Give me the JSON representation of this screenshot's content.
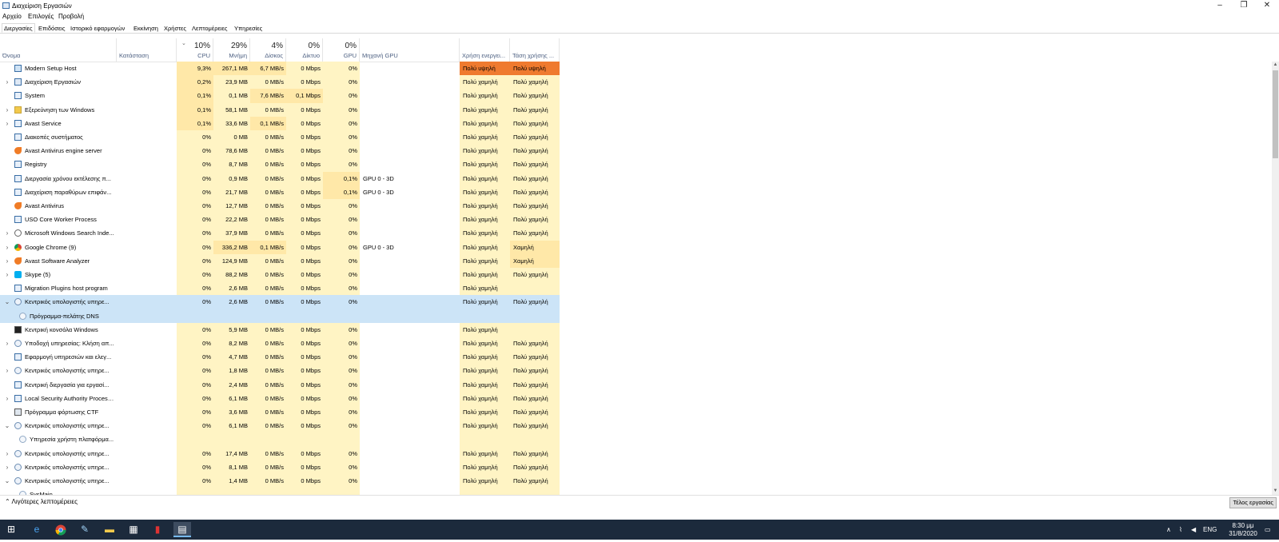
{
  "window": {
    "title": "Διαχείριση Εργασιών"
  },
  "menu": [
    "Αρχείο",
    "Επιλογές",
    "Προβολή"
  ],
  "tabs": [
    "Διεργασίες",
    "Επιδόσεις",
    "Ιστορικό εφαρμογών",
    "Εκκίνηση",
    "Χρήστες",
    "Λεπτομέρειες",
    "Υπηρεσίες"
  ],
  "columns": {
    "name": "Όνομα",
    "status": "Κατάσταση",
    "cpu": {
      "pct": "10%",
      "label": "CPU"
    },
    "mem": {
      "pct": "29%",
      "label": "Μνήμη"
    },
    "disk": {
      "pct": "4%",
      "label": "Δίσκος"
    },
    "net": {
      "pct": "0%",
      "label": "Δίκτυο"
    },
    "gpu": {
      "pct": "0%",
      "label": "GPU"
    },
    "gpu_engine": "Μηχανή GPU",
    "power": "Χρήση ενεργει...",
    "power_trend": "Τάση χρήσης ..."
  },
  "rows": [
    {
      "name": "Modern Setup Host",
      "icon": "setup-icon",
      "expand": "none",
      "cpu": "9,3%",
      "mem": "267,1 MB",
      "disk": "6,7 MB/s",
      "net": "0 Mbps",
      "gpu": "0%",
      "engine": "",
      "power": "Πολύ υψηλή",
      "trend": "Πολύ υψηλή",
      "heat": {
        "cpu": 2,
        "mem": 2,
        "disk": 2,
        "net": 1,
        "gpu": 1,
        "power": "o2",
        "trend": "o2"
      }
    },
    {
      "name": "Διαχείριση Εργασιών",
      "icon": "taskmgr-icon",
      "expand": "collapsed",
      "cpu": "0,2%",
      "mem": "23,9 MB",
      "disk": "0 MB/s",
      "net": "0 Mbps",
      "gpu": "0%",
      "engine": "",
      "power": "Πολύ χαμηλή",
      "trend": "Πολύ χαμηλή",
      "heat": {
        "cpu": 2,
        "mem": 1,
        "disk": 1,
        "net": 1,
        "gpu": 1,
        "power": "y1",
        "trend": "y1"
      }
    },
    {
      "name": "System",
      "icon": "system-icon",
      "expand": "none",
      "cpu": "0,1%",
      "mem": "0,1 MB",
      "disk": "7,6 MB/s",
      "net": "0,1 Mbps",
      "gpu": "0%",
      "engine": "",
      "power": "Πολύ χαμηλή",
      "trend": "Πολύ χαμηλή",
      "heat": {
        "cpu": 2,
        "mem": 1,
        "disk": 2,
        "net": 2,
        "gpu": 1,
        "power": "y1",
        "trend": "y1"
      }
    },
    {
      "name": "Εξερεύνηση των Windows",
      "icon": "folder-icon",
      "expand": "collapsed",
      "cpu": "0,1%",
      "mem": "58,1 MB",
      "disk": "0 MB/s",
      "net": "0 Mbps",
      "gpu": "0%",
      "engine": "",
      "power": "Πολύ χαμηλή",
      "trend": "Πολύ χαμηλή",
      "heat": {
        "cpu": 2,
        "mem": 1,
        "disk": 1,
        "net": 1,
        "gpu": 1,
        "power": "y1",
        "trend": "y1"
      }
    },
    {
      "name": "Avast Service",
      "icon": "app-window-icon",
      "expand": "collapsed",
      "cpu": "0,1%",
      "mem": "33,6 MB",
      "disk": "0,1 MB/s",
      "net": "0 Mbps",
      "gpu": "0%",
      "engine": "",
      "power": "Πολύ χαμηλή",
      "trend": "Πολύ χαμηλή",
      "heat": {
        "cpu": 2,
        "mem": 1,
        "disk": 2,
        "net": 1,
        "gpu": 1,
        "power": "y1",
        "trend": "y1"
      }
    },
    {
      "name": "Διακοπές συστήματος",
      "icon": "system-icon",
      "expand": "none",
      "cpu": "0%",
      "mem": "0 MB",
      "disk": "0 MB/s",
      "net": "0 Mbps",
      "gpu": "0%",
      "engine": "",
      "power": "Πολύ χαμηλή",
      "trend": "Πολύ χαμηλή",
      "heat": {
        "cpu": 1,
        "mem": 1,
        "disk": 1,
        "net": 1,
        "gpu": 1,
        "power": "y1",
        "trend": "y1"
      }
    },
    {
      "name": "Avast Antivirus engine server",
      "icon": "avast-icon",
      "expand": "none",
      "cpu": "0%",
      "mem": "78,6 MB",
      "disk": "0 MB/s",
      "net": "0 Mbps",
      "gpu": "0%",
      "engine": "",
      "power": "Πολύ χαμηλή",
      "trend": "Πολύ χαμηλή",
      "heat": {
        "cpu": 1,
        "mem": 1,
        "disk": 1,
        "net": 1,
        "gpu": 1,
        "power": "y1",
        "trend": "y1"
      }
    },
    {
      "name": "Registry",
      "icon": "app-window-icon",
      "expand": "none",
      "cpu": "0%",
      "mem": "8,7 MB",
      "disk": "0 MB/s",
      "net": "0 Mbps",
      "gpu": "0%",
      "engine": "",
      "power": "Πολύ χαμηλή",
      "trend": "Πολύ χαμηλή",
      "heat": {
        "cpu": 1,
        "mem": 1,
        "disk": 1,
        "net": 1,
        "gpu": 1,
        "power": "y1",
        "trend": "y1"
      }
    },
    {
      "name": "Διεργασία χρόνου εκτέλεσης π...",
      "icon": "app-window-icon",
      "expand": "none",
      "cpu": "0%",
      "mem": "0,9 MB",
      "disk": "0 MB/s",
      "net": "0 Mbps",
      "gpu": "0,1%",
      "engine": "GPU 0 - 3D",
      "power": "Πολύ χαμηλή",
      "trend": "Πολύ χαμηλή",
      "heat": {
        "cpu": 1,
        "mem": 1,
        "disk": 1,
        "net": 1,
        "gpu": 2,
        "power": "y1",
        "trend": "y1"
      }
    },
    {
      "name": "Διαχείριση παραθύρων επιφάν...",
      "icon": "app-window-icon",
      "expand": "none",
      "cpu": "0%",
      "mem": "21,7 MB",
      "disk": "0 MB/s",
      "net": "0 Mbps",
      "gpu": "0,1%",
      "engine": "GPU 0 - 3D",
      "power": "Πολύ χαμηλή",
      "trend": "Πολύ χαμηλή",
      "heat": {
        "cpu": 1,
        "mem": 1,
        "disk": 1,
        "net": 1,
        "gpu": 2,
        "power": "y1",
        "trend": "y1"
      }
    },
    {
      "name": "Avast Antivirus",
      "icon": "avast-icon",
      "expand": "none",
      "cpu": "0%",
      "mem": "12,7 MB",
      "disk": "0 MB/s",
      "net": "0 Mbps",
      "gpu": "0%",
      "engine": "",
      "power": "Πολύ χαμηλή",
      "trend": "Πολύ χαμηλή",
      "heat": {
        "cpu": 1,
        "mem": 1,
        "disk": 1,
        "net": 1,
        "gpu": 1,
        "power": "y1",
        "trend": "y1"
      }
    },
    {
      "name": "USO Core Worker Process",
      "icon": "app-window-icon",
      "expand": "none",
      "cpu": "0%",
      "mem": "22,2 MB",
      "disk": "0 MB/s",
      "net": "0 Mbps",
      "gpu": "0%",
      "engine": "",
      "power": "Πολύ χαμηλή",
      "trend": "Πολύ χαμηλή",
      "heat": {
        "cpu": 1,
        "mem": 1,
        "disk": 1,
        "net": 1,
        "gpu": 1,
        "power": "y1",
        "trend": "y1"
      }
    },
    {
      "name": "Microsoft Windows Search Inde...",
      "icon": "search-indexer-icon",
      "expand": "collapsed",
      "cpu": "0%",
      "mem": "37,9 MB",
      "disk": "0 MB/s",
      "net": "0 Mbps",
      "gpu": "0%",
      "engine": "",
      "power": "Πολύ χαμηλή",
      "trend": "Πολύ χαμηλή",
      "heat": {
        "cpu": 1,
        "mem": 1,
        "disk": 1,
        "net": 1,
        "gpu": 1,
        "power": "y1",
        "trend": "y1"
      }
    },
    {
      "name": "Google Chrome (9)",
      "icon": "chrome-icon",
      "expand": "collapsed",
      "cpu": "0%",
      "mem": "336,2 MB",
      "disk": "0,1 MB/s",
      "net": "0 Mbps",
      "gpu": "0%",
      "engine": "GPU 0 - 3D",
      "power": "Πολύ χαμηλή",
      "trend": "Χαμηλή",
      "heat": {
        "cpu": 1,
        "mem": 2,
        "disk": 2,
        "net": 1,
        "gpu": 1,
        "power": "y1",
        "trend": "y2"
      }
    },
    {
      "name": "Avast Software Analyzer",
      "icon": "avast-icon",
      "expand": "collapsed",
      "cpu": "0%",
      "mem": "124,9 MB",
      "disk": "0 MB/s",
      "net": "0 Mbps",
      "gpu": "0%",
      "engine": "",
      "power": "Πολύ χαμηλή",
      "trend": "Χαμηλή",
      "heat": {
        "cpu": 1,
        "mem": 1,
        "disk": 1,
        "net": 1,
        "gpu": 1,
        "power": "y1",
        "trend": "y2"
      }
    },
    {
      "name": "Skype (5)",
      "icon": "skype-icon",
      "expand": "collapsed",
      "cpu": "0%",
      "mem": "88,2 MB",
      "disk": "0 MB/s",
      "net": "0 Mbps",
      "gpu": "0%",
      "engine": "",
      "power": "Πολύ χαμηλή",
      "trend": "Πολύ χαμηλή",
      "heat": {
        "cpu": 1,
        "mem": 1,
        "disk": 1,
        "net": 1,
        "gpu": 1,
        "power": "y1",
        "trend": "y1"
      }
    },
    {
      "name": "Migration Plugins host program",
      "icon": "app-window-icon",
      "expand": "none",
      "cpu": "0%",
      "mem": "2,6 MB",
      "disk": "0 MB/s",
      "net": "0 Mbps",
      "gpu": "0%",
      "engine": "",
      "power": "Πολύ χαμηλή",
      "trend": "",
      "heat": {
        "cpu": 1,
        "mem": 1,
        "disk": 1,
        "net": 1,
        "gpu": 1,
        "power": "y1",
        "trend": "y1"
      }
    },
    {
      "name": "Κεντρικός υπολογιστής υπηρε...",
      "icon": "gear-icon",
      "expand": "expanded",
      "selected": true,
      "cpu": "0%",
      "mem": "2,6 MB",
      "disk": "0 MB/s",
      "net": "0 Mbps",
      "gpu": "0%",
      "engine": "",
      "power": "Πολύ χαμηλή",
      "trend": "Πολύ χαμηλή",
      "heat": {
        "cpu": 1,
        "mem": 1,
        "disk": 1,
        "net": 1,
        "gpu": 1,
        "power": "y1",
        "trend": "y1"
      }
    },
    {
      "name": "Πρόγραμμα-πελάτης DNS",
      "icon": "service-gear-icon",
      "expand": "child",
      "selected": true,
      "cpu": "",
      "mem": "",
      "disk": "",
      "net": "",
      "gpu": "",
      "engine": "",
      "power": "",
      "trend": "",
      "heat": {}
    },
    {
      "name": "Κεντρική κονσόλα Windows",
      "icon": "console-icon",
      "expand": "none",
      "cpu": "0%",
      "mem": "5,9 MB",
      "disk": "0 MB/s",
      "net": "0 Mbps",
      "gpu": "0%",
      "engine": "",
      "power": "Πολύ χαμηλή",
      "trend": "",
      "heat": {
        "cpu": 1,
        "mem": 1,
        "disk": 1,
        "net": 1,
        "gpu": 1,
        "power": "y1",
        "trend": "y1"
      }
    },
    {
      "name": "Υποδοχή υπηρεσίας: Κλήση απ...",
      "icon": "gear-icon",
      "expand": "collapsed",
      "cpu": "0%",
      "mem": "8,2 MB",
      "disk": "0 MB/s",
      "net": "0 Mbps",
      "gpu": "0%",
      "engine": "",
      "power": "Πολύ χαμηλή",
      "trend": "Πολύ χαμηλή",
      "heat": {
        "cpu": 1,
        "mem": 1,
        "disk": 1,
        "net": 1,
        "gpu": 1,
        "power": "y1",
        "trend": "y1"
      }
    },
    {
      "name": "Εφαρμογή υπηρεσιών και ελεγ...",
      "icon": "app-window-icon",
      "expand": "none",
      "cpu": "0%",
      "mem": "4,7 MB",
      "disk": "0 MB/s",
      "net": "0 Mbps",
      "gpu": "0%",
      "engine": "",
      "power": "Πολύ χαμηλή",
      "trend": "Πολύ χαμηλή",
      "heat": {
        "cpu": 1,
        "mem": 1,
        "disk": 1,
        "net": 1,
        "gpu": 1,
        "power": "y1",
        "trend": "y1"
      }
    },
    {
      "name": "Κεντρικός υπολογιστής υπηρε...",
      "icon": "gear-icon",
      "expand": "collapsed",
      "cpu": "0%",
      "mem": "1,8 MB",
      "disk": "0 MB/s",
      "net": "0 Mbps",
      "gpu": "0%",
      "engine": "",
      "power": "Πολύ χαμηλή",
      "trend": "Πολύ χαμηλή",
      "heat": {
        "cpu": 1,
        "mem": 1,
        "disk": 1,
        "net": 1,
        "gpu": 1,
        "power": "y1",
        "trend": "y1"
      }
    },
    {
      "name": "Κεντρική διεργασία για εργασί...",
      "icon": "app-window-icon",
      "expand": "none",
      "cpu": "0%",
      "mem": "2,4 MB",
      "disk": "0 MB/s",
      "net": "0 Mbps",
      "gpu": "0%",
      "engine": "",
      "power": "Πολύ χαμηλή",
      "trend": "Πολύ χαμηλή",
      "heat": {
        "cpu": 1,
        "mem": 1,
        "disk": 1,
        "net": 1,
        "gpu": 1,
        "power": "y1",
        "trend": "y1"
      }
    },
    {
      "name": "Local Security Authority Process...",
      "icon": "app-window-icon",
      "expand": "collapsed",
      "cpu": "0%",
      "mem": "6,1 MB",
      "disk": "0 MB/s",
      "net": "0 Mbps",
      "gpu": "0%",
      "engine": "",
      "power": "Πολύ χαμηλή",
      "trend": "Πολύ χαμηλή",
      "heat": {
        "cpu": 1,
        "mem": 1,
        "disk": 1,
        "net": 1,
        "gpu": 1,
        "power": "y1",
        "trend": "y1"
      }
    },
    {
      "name": "Πρόγραμμα φόρτωσης CTF",
      "icon": "ctf-icon",
      "expand": "none",
      "cpu": "0%",
      "mem": "3,6 MB",
      "disk": "0 MB/s",
      "net": "0 Mbps",
      "gpu": "0%",
      "engine": "",
      "power": "Πολύ χαμηλή",
      "trend": "Πολύ χαμηλή",
      "heat": {
        "cpu": 1,
        "mem": 1,
        "disk": 1,
        "net": 1,
        "gpu": 1,
        "power": "y1",
        "trend": "y1"
      }
    },
    {
      "name": "Κεντρικός υπολογιστής υπηρε...",
      "icon": "gear-icon",
      "expand": "expanded",
      "cpu": "0%",
      "mem": "6,1 MB",
      "disk": "0 MB/s",
      "net": "0 Mbps",
      "gpu": "0%",
      "engine": "",
      "power": "Πολύ χαμηλή",
      "trend": "Πολύ χαμηλή",
      "heat": {
        "cpu": 1,
        "mem": 1,
        "disk": 1,
        "net": 1,
        "gpu": 1,
        "power": "y1",
        "trend": "y1"
      }
    },
    {
      "name": "Υπηρεσία χρήστη πλατφόρμα...",
      "icon": "service-gear-icon",
      "expand": "child",
      "cpu": "",
      "mem": "",
      "disk": "",
      "net": "",
      "gpu": "",
      "engine": "",
      "power": "",
      "trend": "",
      "heat": {}
    },
    {
      "name": "Κεντρικός υπολογιστής υπηρε...",
      "icon": "gear-icon",
      "expand": "collapsed",
      "cpu": "0%",
      "mem": "17,4 MB",
      "disk": "0 MB/s",
      "net": "0 Mbps",
      "gpu": "0%",
      "engine": "",
      "power": "Πολύ χαμηλή",
      "trend": "Πολύ χαμηλή",
      "heat": {
        "cpu": 1,
        "mem": 1,
        "disk": 1,
        "net": 1,
        "gpu": 1,
        "power": "y1",
        "trend": "y1"
      }
    },
    {
      "name": "Κεντρικός υπολογιστής υπηρε...",
      "icon": "gear-icon",
      "expand": "collapsed",
      "cpu": "0%",
      "mem": "8,1 MB",
      "disk": "0 MB/s",
      "net": "0 Mbps",
      "gpu": "0%",
      "engine": "",
      "power": "Πολύ χαμηλή",
      "trend": "Πολύ χαμηλή",
      "heat": {
        "cpu": 1,
        "mem": 1,
        "disk": 1,
        "net": 1,
        "gpu": 1,
        "power": "y1",
        "trend": "y1"
      }
    },
    {
      "name": "Κεντρικός υπολογιστής υπηρε...",
      "icon": "gear-icon",
      "expand": "expanded",
      "cpu": "0%",
      "mem": "1,4 MB",
      "disk": "0 MB/s",
      "net": "0 Mbps",
      "gpu": "0%",
      "engine": "",
      "power": "Πολύ χαμηλή",
      "trend": "Πολύ χαμηλή",
      "heat": {
        "cpu": 1,
        "mem": 1,
        "disk": 1,
        "net": 1,
        "gpu": 1,
        "power": "y1",
        "trend": "y1"
      }
    },
    {
      "name": "SysMain",
      "icon": "service-gear-icon",
      "expand": "child",
      "cpu": "",
      "mem": "",
      "disk": "",
      "net": "",
      "gpu": "",
      "engine": "",
      "power": "",
      "trend": "",
      "heat": {}
    }
  ],
  "footer": {
    "less_details": "Λιγότερες λεπτομέρειες",
    "end_task": "Τέλος εργασίας"
  },
  "tray": {
    "lang": "ENG",
    "time": "8:30 μμ",
    "date": "31/8/2020"
  },
  "colors": {
    "heat_light": "#fff4c4",
    "heat_mid": "#ffe8a8",
    "very_high": "#ef7a2f",
    "selected": "#cce4f7",
    "taskbar": "#1c2a3c"
  }
}
